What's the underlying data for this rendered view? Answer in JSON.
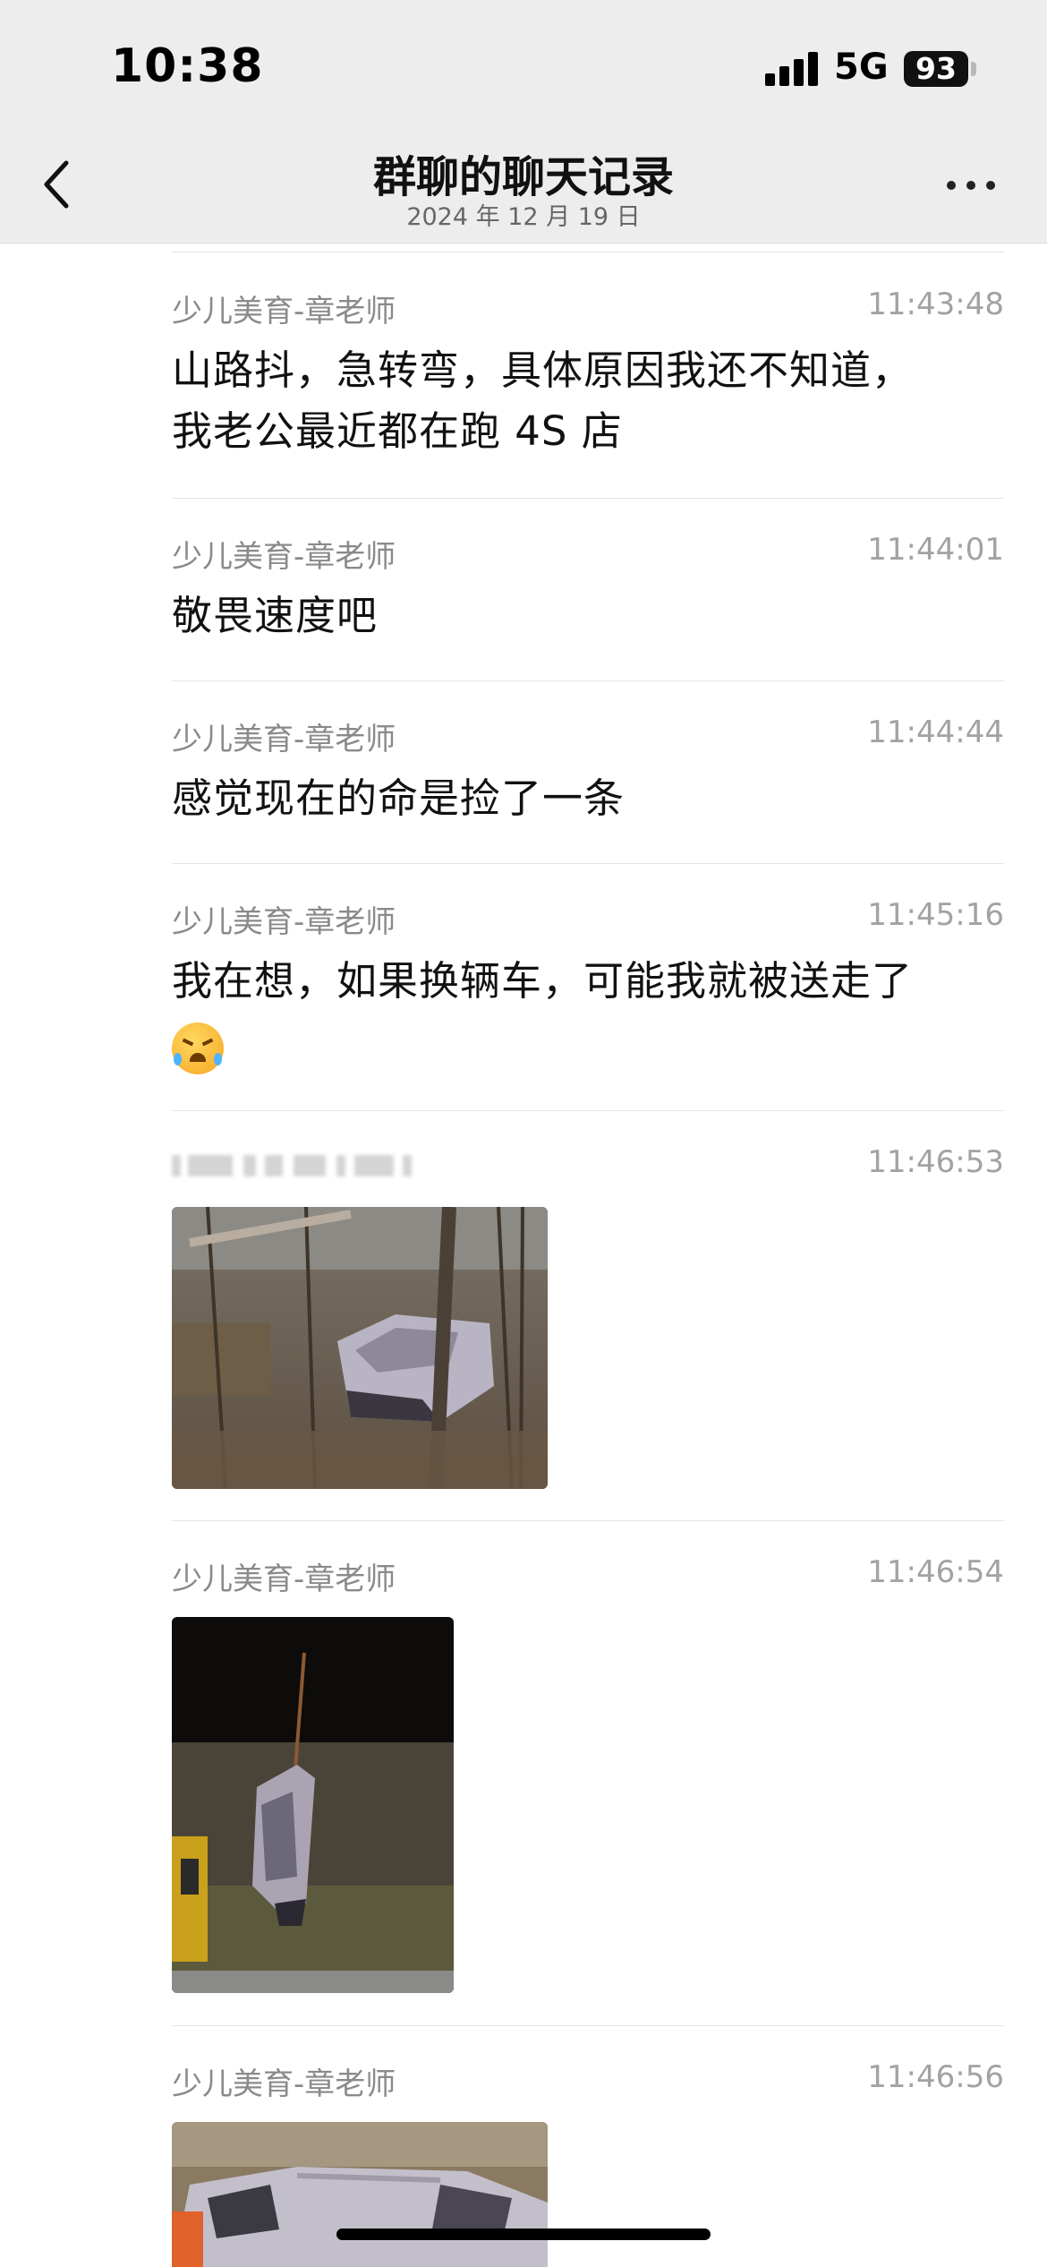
{
  "status_bar": {
    "time": "10:38",
    "network": "5G",
    "battery": "93"
  },
  "nav": {
    "title": "群聊的聊天记录",
    "date": "2024 年 12 月 19 日"
  },
  "messages": [
    {
      "sender": "少儿美育-章老师",
      "time": "11:43:48",
      "text_lines": [
        "山路抖，急转弯，具体原因我还不知道，",
        "我老公最近都在跑 4S 店"
      ]
    },
    {
      "sender": "少儿美育-章老师",
      "time": "11:44:01",
      "text_lines": [
        "敬畏速度吧"
      ]
    },
    {
      "sender": "少儿美育-章老师",
      "time": "11:44:44",
      "text_lines": [
        "感觉现在的命是捡了一条"
      ]
    },
    {
      "sender": "少儿美育-章老师",
      "time": "11:45:16",
      "text_lines": [
        "我在想，如果换辆车，可能我就被送走了"
      ],
      "emoji": "crying-laughing-emoji"
    },
    {
      "sender": "",
      "sender_blurred": true,
      "time": "11:46:53",
      "image": "crashed car in woods"
    },
    {
      "sender": "少儿美育-章老师",
      "time": "11:46:54",
      "image": "car lifted by crane"
    },
    {
      "sender": "少儿美育-章老师",
      "time": "11:46:56",
      "image": "damaged car close-up"
    }
  ],
  "icons": {
    "back": "chevron-left-icon",
    "more": "more-horizontal-icon",
    "signal": "signal-bars-icon",
    "battery": "battery-icon"
  }
}
